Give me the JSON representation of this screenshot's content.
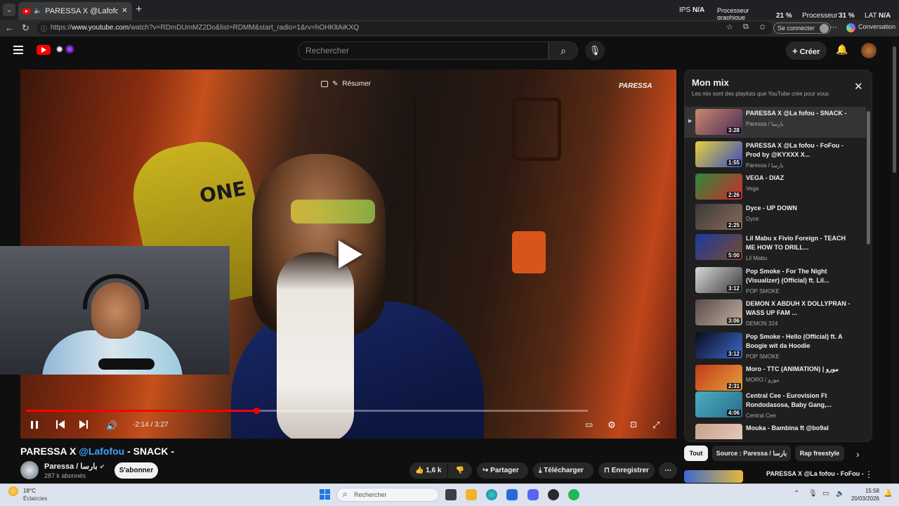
{
  "browser": {
    "tab_title": "PARESSA X @Lafofou - SNAC",
    "url_prefix": "https://",
    "url_domain": "www.youtube.com",
    "url_path": "/watch?v=RDmDUmMZ2Do&list=RDMM&start_radio=1&rv=hOHKltAiKXQ",
    "signin_label": "Se connecter",
    "conversation_label": "Conversation"
  },
  "overlay_stats": {
    "ips_label": "IPS",
    "ips_value": "N/A",
    "gpu_label_1": "Processeur",
    "gpu_label_2": "graphique",
    "gpu_value": "21 %",
    "cpu_label": "Processeur",
    "cpu_value": "31 %",
    "lat_label": "LAT",
    "lat_value": "N/A"
  },
  "header": {
    "search_placeholder": "Rechercher",
    "create_label": "Créer"
  },
  "player": {
    "resume_label": "Résumer",
    "watermark": "PARESSA",
    "time": "-2:14 / 3:27",
    "progress_fraction": 0.41,
    "chair_text": "ONE"
  },
  "video": {
    "title_prefix": "PARESSA X ",
    "title_mention": "@Lafofou",
    "title_suffix": " - SNACK -",
    "channel": "Paressa / بارسا",
    "subscribers": "287 k abonnés",
    "subscribe_label": "S'abonner",
    "likes": "1,6 k",
    "share_label": "Partager",
    "download_label": "Télécharger",
    "save_label": "Enregistrer"
  },
  "mix": {
    "title": "Mon mix",
    "subtitle": "Les mix sont des playlists que YouTube crée pour vous",
    "items": [
      {
        "title": "PARESSA X @La fofou - SNACK -",
        "channel": "Paressa / بارسا",
        "duration": "3:28",
        "colors": [
          "#c98a6a",
          "#4a2a5a"
        ]
      },
      {
        "title": "PARESSA X @La fofou - FoFou - Prod by @KYXXX X...",
        "channel": "Paressa / بارسا",
        "duration": "1:55",
        "colors": [
          "#e6d23a",
          "#3a4ac0"
        ]
      },
      {
        "title": "VEGA - DIAZ",
        "channel": "Vega",
        "duration": "2:26",
        "colors": [
          "#2a8a3a",
          "#d02a2a"
        ]
      },
      {
        "title": "Dyce - UP DOWN",
        "channel": "Dyce",
        "duration": "2:25",
        "colors": [
          "#3a3a3a",
          "#8a6a5a"
        ]
      },
      {
        "title": "Lil Mabu x Fivio Foreign - TEACH ME HOW TO DRILL...",
        "channel": "Lil Mabu",
        "duration": "5:00",
        "colors": [
          "#1a3aa0",
          "#7a4a2a"
        ]
      },
      {
        "title": "Pop Smoke - For The Night (Visualizer) (Official) ft. Lil...",
        "channel": "POP SMOKE",
        "duration": "3:12",
        "colors": [
          "#d8d8d8",
          "#3a3a3a"
        ]
      },
      {
        "title": "DEMON X ABDUH X DOLLYPRAN - WASS UP FAM ...",
        "channel": "DEMON 324",
        "duration": "3:06",
        "colors": [
          "#5a4a4a",
          "#c0b0a0"
        ]
      },
      {
        "title": "Pop Smoke - Hello (Official) ft. A Boogie wit da Hoodie",
        "channel": "POP SMOKE",
        "duration": "3:12",
        "colors": [
          "#0a0a1a",
          "#3a6ad0"
        ]
      },
      {
        "title": "Moro - TTC (ANIMATION) | مورو",
        "channel": "MORO / مورو",
        "duration": "2:31",
        "colors": [
          "#c03a1a",
          "#e8a03a"
        ]
      },
      {
        "title": "Central Cee - Eurovision Ft Rondodasosa, Baby Gang,...",
        "channel": "Central Cee",
        "duration": "4:06",
        "colors": [
          "#4ab0c0",
          "#2a6a8a"
        ]
      },
      {
        "title": "Mouka - Bambina ft @bo9al",
        "channel": "",
        "duration": "",
        "colors": [
          "#c8a08a",
          "#e8d0c0"
        ]
      }
    ]
  },
  "chips": [
    "Tout",
    "Source : Paressa / بارسا",
    "Rap freestyle"
  ],
  "recommendation": {
    "title": "PARESSA X @La fofou - FoFou -"
  },
  "taskbar": {
    "temperature": "18°C",
    "weather": "Éclaircies",
    "search_placeholder": "Rechercher",
    "time": "15:58",
    "date": "20/03/2026"
  }
}
